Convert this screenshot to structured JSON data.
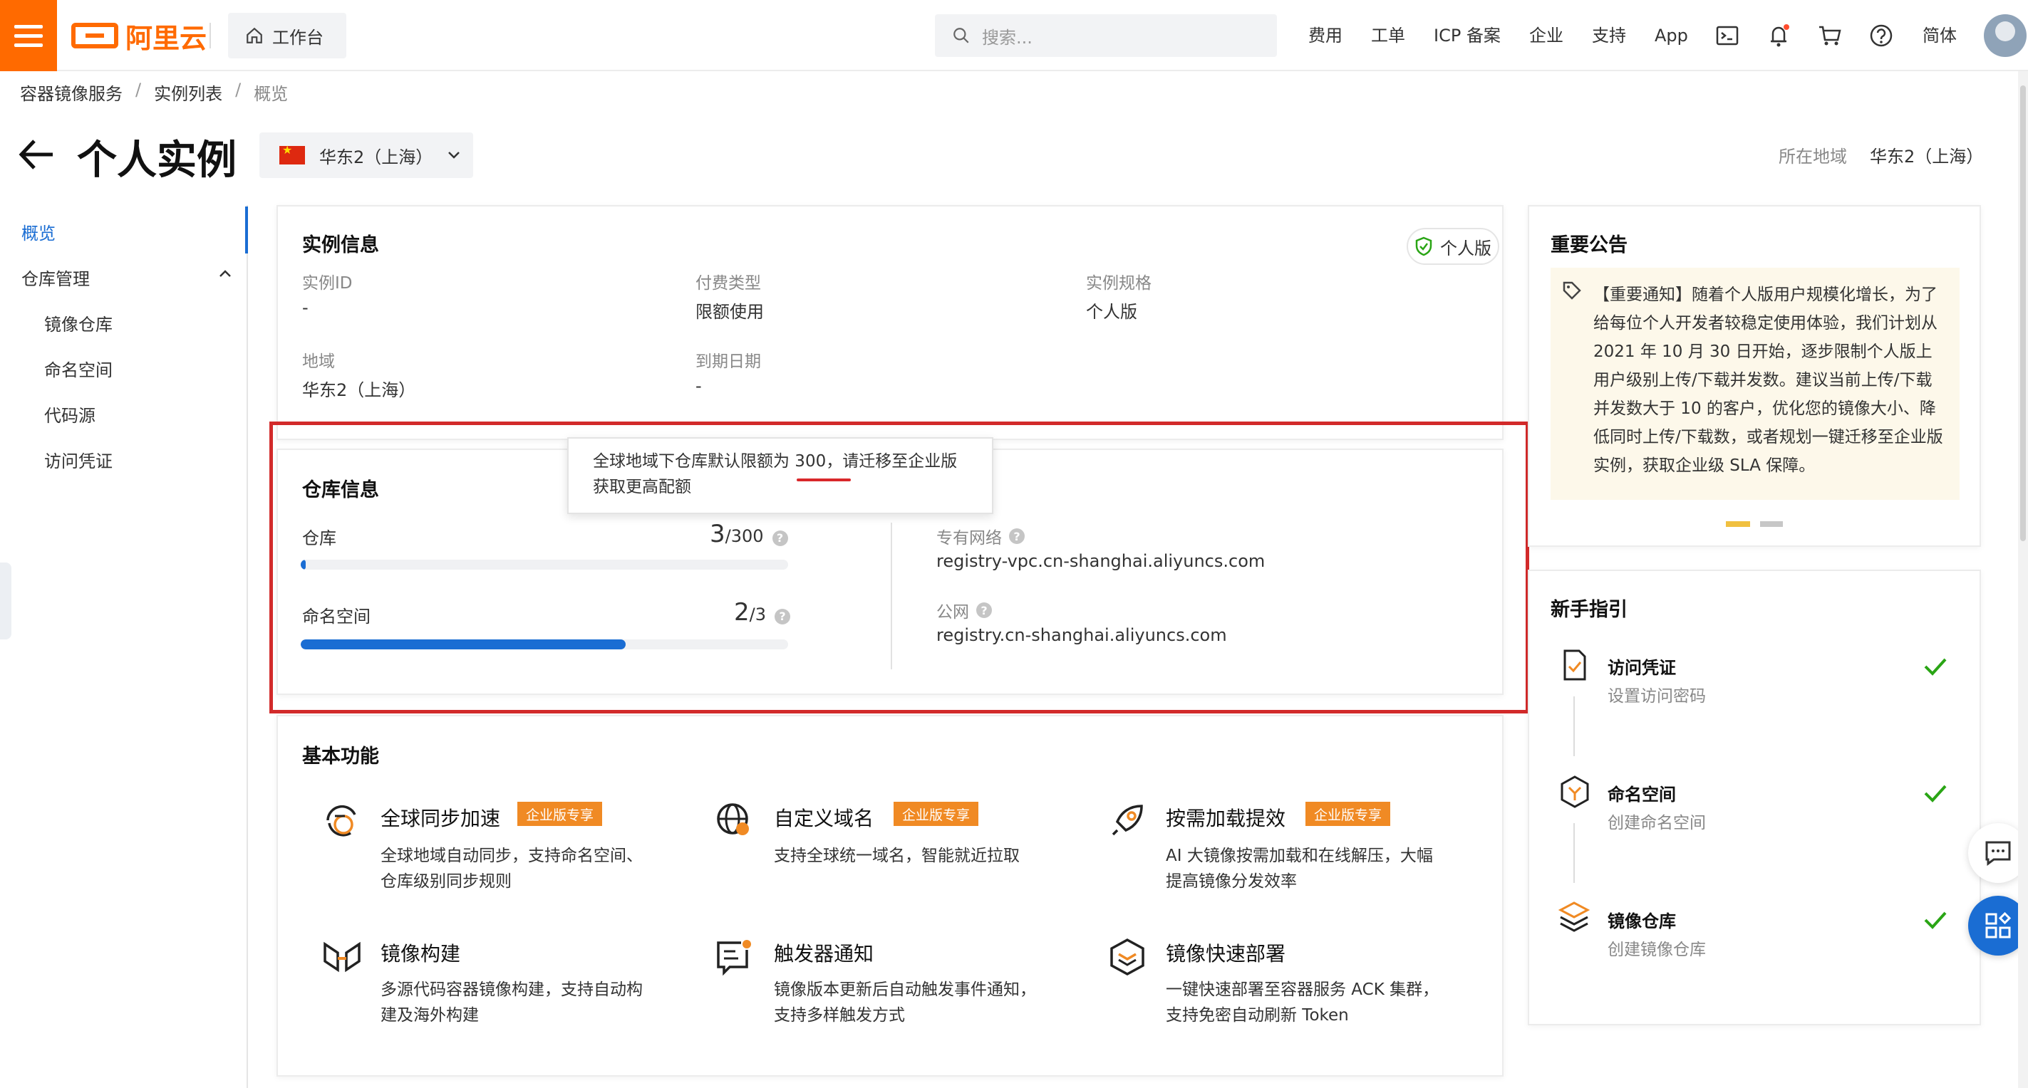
{
  "topbar": {
    "logo_text": "阿里云",
    "workbench_label": "工作台",
    "search_placeholder": "搜索...",
    "nav_links": [
      "费用",
      "工单",
      "ICP 备案",
      "企业",
      "支持",
      "App"
    ],
    "lang": "简体"
  },
  "breadcrumb": [
    "容器镜像服务",
    "实例列表",
    "概览"
  ],
  "header": {
    "title": "个人实例",
    "region_selected": "华东2（上海）",
    "region_label": "所在地域",
    "region_value": "华东2（上海）"
  },
  "sidebar": {
    "overview": "概览",
    "repo_mgmt": "仓库管理",
    "items": [
      "镜像仓库",
      "命名空间",
      "代码源",
      "访问凭证"
    ]
  },
  "instance": {
    "title": "实例信息",
    "badge": "个人版",
    "fields": [
      {
        "label": "实例ID",
        "value": "-"
      },
      {
        "label": "付费类型",
        "value": "限额使用"
      },
      {
        "label": "实例规格",
        "value": "个人版"
      },
      {
        "label": "地域",
        "value": "华东2（上海）"
      },
      {
        "label": "到期日期",
        "value": "-"
      }
    ]
  },
  "repo": {
    "title": "仓库信息",
    "tooltip_line1": "全球地域下仓库默认限额为 300，请迁移至企业版",
    "tooltip_line2": "获取更高配额",
    "repos_label": "仓库",
    "repos_used": "3",
    "repos_total": "/300",
    "repos_fraction": 0.01,
    "ns_label": "命名空间",
    "ns_used": "2",
    "ns_total": "/3",
    "ns_fraction": 0.667,
    "vpc_label": "专有网络",
    "vpc_value": "registry-vpc.cn-shanghai.aliyuncs.com",
    "public_label": "公网",
    "public_value": "registry.cn-shanghai.aliyuncs.com"
  },
  "features": {
    "title": "基本功能",
    "enterprise_tag": "企业版专享",
    "items": [
      {
        "title": "全球同步加速",
        "desc1": "全球地域自动同步，支持命名空间、",
        "desc2": "仓库级别同步规则",
        "icon": "globe-sync-icon"
      },
      {
        "title": "自定义域名",
        "desc1": "支持全球统一域名，智能就近拉取",
        "desc2": "",
        "icon": "domain-icon"
      },
      {
        "title": "按需加载提效",
        "desc1": "AI 大镜像按需加载和在线解压，大幅",
        "desc2": "提高镜像分发效率",
        "icon": "rocket-icon"
      },
      {
        "title": "镜像构建",
        "desc1": "多源代码容器镜像构建，支持自动构",
        "desc2": "建及海外构建",
        "icon": "build-icon"
      },
      {
        "title": "触发器通知",
        "desc1": "镜像版本更新后自动触发事件通知，",
        "desc2": "支持多样触发方式",
        "icon": "trigger-icon"
      },
      {
        "title": "镜像快速部署",
        "desc1": "一键快速部署至容器服务 ACK 集群，",
        "desc2": "支持免密自动刷新 Token",
        "icon": "deploy-icon"
      }
    ]
  },
  "notice": {
    "title": "重要公告",
    "text": "【重要通知】随着个人版用户规模化增长，为了给每位个人开发者较稳定使用体验，我们计划从 2021 年 10 月 30 日开始，逐步限制个人版上用户级别上传/下载并发数。建议当前上传/下载并发数大于 10 的客户，优化您的镜像大小、降低同时上传/下载数，或者规划一键迁移至企业版实例，获取企业级 SLA 保障。"
  },
  "guide": {
    "title": "新手指引",
    "steps": [
      {
        "title": "访问凭证",
        "sub": "设置访问密码"
      },
      {
        "title": "命名空间",
        "sub": "创建命名空间"
      },
      {
        "title": "镜像仓库",
        "sub": "创建镜像仓库"
      }
    ]
  },
  "colors": {
    "brand": "#ff6a00",
    "primary": "#1a6dd3",
    "highlight": "#d22a2a",
    "success": "#2aa515",
    "enterprise_tag": "#f08a24"
  }
}
